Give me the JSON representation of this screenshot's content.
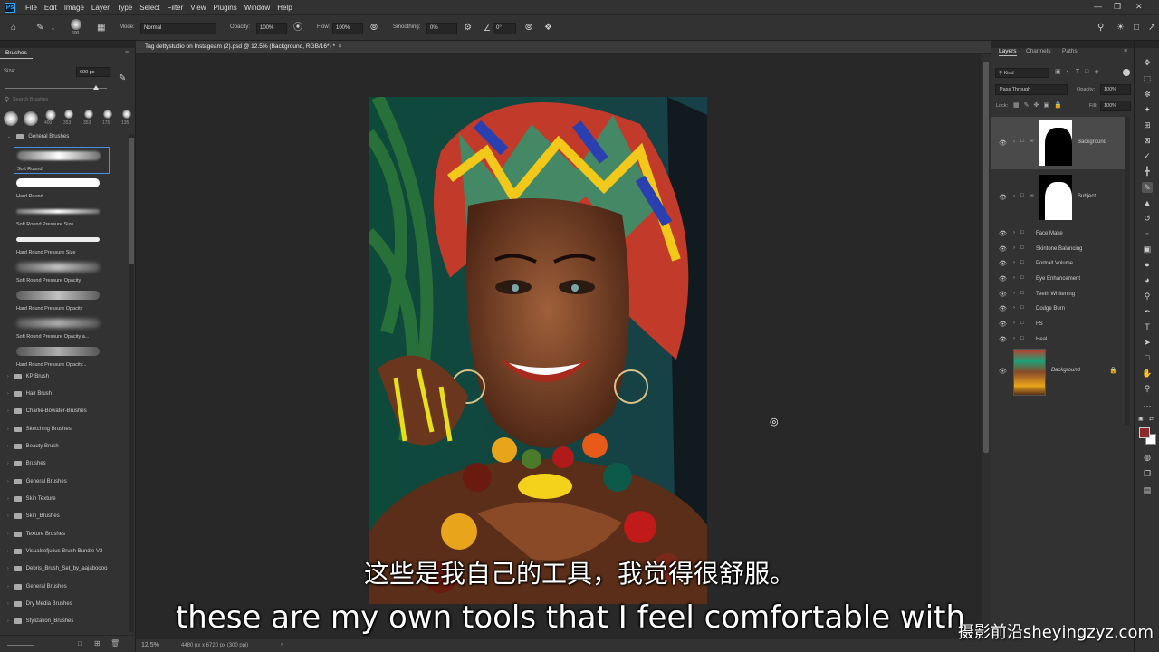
{
  "menubar": {
    "logo": "Ps",
    "items": [
      "File",
      "Edit",
      "Image",
      "Layer",
      "Type",
      "Select",
      "Filter",
      "View",
      "Plugins",
      "Window",
      "Help"
    ]
  },
  "options": {
    "brush_size": "600",
    "mode_label": "Mode:",
    "mode_value": "Normal",
    "opacity_label": "Opacity:",
    "opacity_value": "100%",
    "flow_label": "Flow:",
    "flow_value": "100%",
    "smoothing_label": "Smoothing:",
    "smoothing_value": "0%",
    "angle_value": "0°"
  },
  "brushes_panel": {
    "tab": "Brushes",
    "size_label": "Size:",
    "size_value": "600 px",
    "search_placeholder": "Search Brushes",
    "tip_sizes": [
      "400",
      "353",
      "353",
      "175",
      "135"
    ],
    "group_title": "General Brushes",
    "presets": [
      "Soft Round",
      "Hard Round",
      "Soft Round Pressure Size",
      "Hard Round Pressure Size",
      "Soft Round Pressure Opacity",
      "Hard Round Pressure Opacity",
      "Soft Round Pressure Opacity a...",
      "Hard Round Pressure Opacity..."
    ],
    "folders": [
      "KP Brush",
      "Hair Brush",
      "Charlie-Bowater-Brushes",
      "Sketching Brushes",
      "Beauty Brush",
      "Brushes",
      "General Brushes",
      "Skin Texture",
      "Skin_Brushes",
      "Texture Brushes",
      "Visualsofjulius Brush Bundle V2",
      "Debris_Brush_Set_by_aajaboooo",
      "General Brushes",
      "Dry Media Brushes",
      "Stylization_Brushes"
    ]
  },
  "document": {
    "tab_title": "Tag dettystudio on Instageam (2).psd @ 12.5% (Background, RGB/16*) *",
    "zoom": "12.5%",
    "info": "4480 px x 6720 px (300 ppi)"
  },
  "layers_panel": {
    "tabs": [
      "Layers",
      "Channels",
      "Paths"
    ],
    "filter_value": "Kind",
    "blend_value": "Pass Through",
    "opacity_label": "Opacity:",
    "opacity_value": "100%",
    "lock_label": "Lock:",
    "fill_label": "Fill:",
    "fill_value": "100%",
    "masked_layers": [
      "Background",
      "Subject"
    ],
    "groups": [
      "Face Make",
      "Skintone Balancing",
      "Portrait Volume",
      "Eye Enhancement",
      "Teeth Whitening",
      "Dodge Burn",
      "FS",
      "Heal"
    ],
    "bg_layer": "Background"
  },
  "subtitles": {
    "chinese": "这些是我自己的工具，我觉得很舒服。",
    "english": "these are my own tools that I feel comfortable with"
  },
  "watermark": "摄影前沿sheyingzyz.com",
  "colors": {
    "accent": "#31a8ff",
    "foreground_swatch": "#8b2a2a",
    "background_swatch": "#ffffff"
  }
}
